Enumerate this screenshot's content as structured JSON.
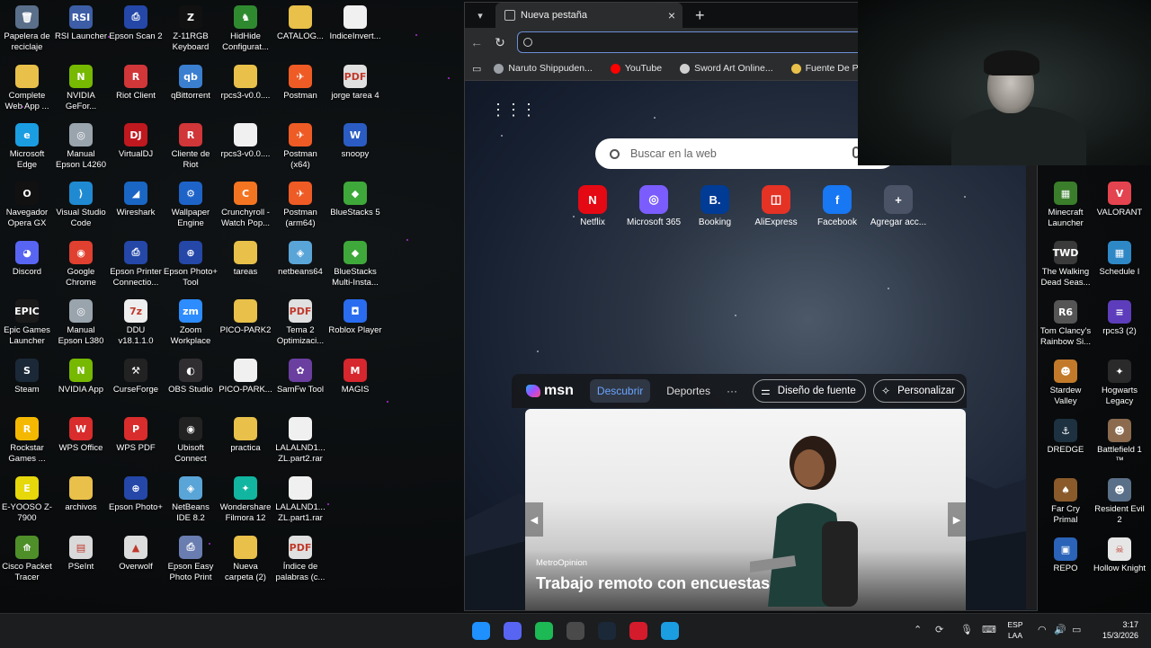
{
  "desktop": {
    "left_icons": [
      {
        "label": "Papelera de reciclaje",
        "icon": "recycle-bin-icon",
        "color": "#5a6f8a",
        "glyph": "🗑"
      },
      {
        "label": "RSI Launcher",
        "icon": "rsi-launcher-icon",
        "color": "#3d5ea6",
        "glyph": "RSI"
      },
      {
        "label": "Epson Scan 2",
        "icon": "epson-scan-icon",
        "color": "#2447a8",
        "glyph": "⎙"
      },
      {
        "label": "Z-11RGB Keyboard",
        "icon": "keyboard-icon",
        "color": "#111111",
        "glyph": "Z"
      },
      {
        "label": "HidHide Configurat...",
        "icon": "hidhide-icon",
        "color": "#2f8a2f",
        "glyph": "♞"
      },
      {
        "label": "CATALOG...",
        "icon": "folder-icon",
        "color": "#e8c04a",
        "glyph": ""
      },
      {
        "label": "IndiceInvert...",
        "icon": "file-icon",
        "color": "#f0f0f0",
        "glyph": ""
      },
      {
        "label": "Complete Web App ...",
        "icon": "folder-icon",
        "color": "#e8c04a",
        "glyph": ""
      },
      {
        "label": "NVIDIA GeFor...",
        "icon": "nvidia-icon",
        "color": "#76b900",
        "glyph": "N"
      },
      {
        "label": "Riot Client",
        "icon": "riot-icon",
        "color": "#d13639",
        "glyph": "R"
      },
      {
        "label": "qBittorrent",
        "icon": "qbittorrent-icon",
        "color": "#3b7fd1",
        "glyph": "qb"
      },
      {
        "label": "rpcs3-v0.0....",
        "icon": "folder-icon",
        "color": "#e8c04a",
        "glyph": ""
      },
      {
        "label": "Postman",
        "icon": "postman-icon",
        "color": "#ef5b25",
        "glyph": "✈"
      },
      {
        "label": "jorge tarea 4",
        "icon": "pdf-icon",
        "color": "#e0e0e0",
        "glyph": "PDF"
      },
      {
        "label": "Microsoft Edge",
        "icon": "edge-icon",
        "color": "#1b9de2",
        "glyph": "e"
      },
      {
        "label": "Manual Epson L4260",
        "icon": "cd-icon",
        "color": "#9aa4ad",
        "glyph": "◎"
      },
      {
        "label": "VirtualDJ",
        "icon": "virtualdj-icon",
        "color": "#c0181f",
        "glyph": "DJ"
      },
      {
        "label": "Cliente de Riot",
        "icon": "riot-icon",
        "color": "#d13639",
        "glyph": "R"
      },
      {
        "label": "rpcs3-v0.0....",
        "icon": "file-icon",
        "color": "#f0f0f0",
        "glyph": ""
      },
      {
        "label": "Postman (x64)",
        "icon": "postman-icon",
        "color": "#ef5b25",
        "glyph": "✈"
      },
      {
        "label": "snoopy",
        "icon": "word-icon",
        "color": "#2b5cc4",
        "glyph": "W"
      },
      {
        "label": "Navegador Opera GX",
        "icon": "opera-gx-icon",
        "color": "#111111",
        "glyph": "O"
      },
      {
        "label": "Visual Studio Code",
        "icon": "vscode-icon",
        "color": "#1f8ad2",
        "glyph": "⟩"
      },
      {
        "label": "Wireshark",
        "icon": "wireshark-icon",
        "color": "#1a66c4",
        "glyph": "◢"
      },
      {
        "label": "Wallpaper Engine",
        "icon": "wallpaper-engine-icon",
        "color": "#1e64c8",
        "glyph": "⚙"
      },
      {
        "label": "Crunchyroll - Watch Pop...",
        "icon": "crunchyroll-icon",
        "color": "#f47521",
        "glyph": "C"
      },
      {
        "label": "Postman (arm64)",
        "icon": "postman-icon",
        "color": "#ef5b25",
        "glyph": "✈"
      },
      {
        "label": "BlueStacks 5",
        "icon": "bluestacks-icon",
        "color": "#3fa83a",
        "glyph": "◆"
      },
      {
        "label": "Discord",
        "icon": "discord-icon",
        "color": "#5865f2",
        "glyph": "◕"
      },
      {
        "label": "Google Chrome",
        "icon": "chrome-icon",
        "color": "#e0402f",
        "glyph": "◉"
      },
      {
        "label": "Epson Printer Connectio...",
        "icon": "epson-printer-icon",
        "color": "#2447a8",
        "glyph": "⎙"
      },
      {
        "label": "Epson Photo+ Tool",
        "icon": "epson-photo-icon",
        "color": "#2447a8",
        "glyph": "⊕"
      },
      {
        "label": "tareas",
        "icon": "folder-icon",
        "color": "#e8c04a",
        "glyph": ""
      },
      {
        "label": "netbeans64",
        "icon": "netbeans-icon",
        "color": "#5aa5d8",
        "glyph": "◈"
      },
      {
        "label": "BlueStacks Multi-Insta...",
        "icon": "bluestacks-icon",
        "color": "#3fa83a",
        "glyph": "◆"
      },
      {
        "label": "Epic Games Launcher",
        "icon": "epic-games-icon",
        "color": "#1a1a1a",
        "glyph": "EPIC"
      },
      {
        "label": "Manual Epson L380",
        "icon": "cd-icon",
        "color": "#9aa4ad",
        "glyph": "◎"
      },
      {
        "label": "DDU v18.1.1.0",
        "icon": "ddu-icon",
        "color": "#eeeeee",
        "glyph": "7z"
      },
      {
        "label": "Zoom Workplace",
        "icon": "zoom-icon",
        "color": "#2d8cff",
        "glyph": "zm"
      },
      {
        "label": "PICO-PARK2",
        "icon": "folder-icon",
        "color": "#e8c04a",
        "glyph": ""
      },
      {
        "label": "Tema 2 Optimizaci...",
        "icon": "pdf-icon",
        "color": "#e0e0e0",
        "glyph": "PDF"
      },
      {
        "label": "Roblox Player",
        "icon": "roblox-icon",
        "color": "#2a6cf0",
        "glyph": "◘"
      },
      {
        "label": "Steam",
        "icon": "steam-icon",
        "color": "#1b2838",
        "glyph": "S"
      },
      {
        "label": "NVIDIA App",
        "icon": "nvidia-icon",
        "color": "#76b900",
        "glyph": "N"
      },
      {
        "label": "CurseForge",
        "icon": "curseforge-icon",
        "color": "#222222",
        "glyph": "⚒"
      },
      {
        "label": "OBS Studio",
        "icon": "obs-icon",
        "color": "#302e31",
        "glyph": "◐"
      },
      {
        "label": "PICO-PARK...",
        "icon": "file-icon",
        "color": "#f0f0f0",
        "glyph": ""
      },
      {
        "label": "SamFw Tool",
        "icon": "samfw-icon",
        "color": "#6b3fa0",
        "glyph": "✿"
      },
      {
        "label": "MAGIS",
        "icon": "magis-icon",
        "color": "#d6262e",
        "glyph": "M"
      },
      {
        "label": "Rockstar Games ...",
        "icon": "rockstar-icon",
        "color": "#f5b800",
        "glyph": "R"
      },
      {
        "label": "WPS Office",
        "icon": "wps-office-icon",
        "color": "#d92c2c",
        "glyph": "W"
      },
      {
        "label": "WPS PDF",
        "icon": "wps-pdf-icon",
        "color": "#d92c2c",
        "glyph": "P"
      },
      {
        "label": "Ubisoft Connect",
        "icon": "ubisoft-icon",
        "color": "#222222",
        "glyph": "◉"
      },
      {
        "label": "practica",
        "icon": "folder-icon",
        "color": "#e8c04a",
        "glyph": ""
      },
      {
        "label": "LALALND1... ZL.part2.rar",
        "icon": "file-icon",
        "color": "#f0f0f0",
        "glyph": ""
      },
      {
        "label": "E-YOOSO Z-7900",
        "icon": "eyooso-icon",
        "color": "#e6d80b",
        "glyph": "E"
      },
      {
        "label": "archivos",
        "icon": "folder-icon",
        "color": "#e8c04a",
        "glyph": ""
      },
      {
        "label": "Epson Photo+",
        "icon": "epson-photo-icon",
        "color": "#2447a8",
        "glyph": "⊕"
      },
      {
        "label": "NetBeans IDE 8.2",
        "icon": "netbeans-icon",
        "color": "#5aa5d8",
        "glyph": "◈"
      },
      {
        "label": "Wondershare Filmora 12",
        "icon": "filmora-icon",
        "color": "#11b5a0",
        "glyph": "✦"
      },
      {
        "label": "LALALND1... ZL.part1.rar",
        "icon": "file-icon",
        "color": "#f0f0f0",
        "glyph": ""
      },
      {
        "label": "Cisco Packet Tracer",
        "icon": "cisco-packet-tracer-icon",
        "color": "#4f8f2a",
        "glyph": "⟰"
      },
      {
        "label": "PSeInt",
        "icon": "pseint-icon",
        "color": "#d9d9d9",
        "glyph": "▤"
      },
      {
        "label": "Overwolf",
        "icon": "overwolf-icon",
        "color": "#dddddd",
        "glyph": "▲"
      },
      {
        "label": "Epson Easy Photo Print",
        "icon": "epson-easy-photo-icon",
        "color": "#6a7db0",
        "glyph": "⎙"
      },
      {
        "label": "Nueva carpeta (2)",
        "icon": "folder-icon",
        "color": "#e8c04a",
        "glyph": ""
      },
      {
        "label": "Índice de palabras (c...",
        "icon": "pdf-icon",
        "color": "#e0e0e0",
        "glyph": "PDF"
      }
    ],
    "right_icons": [
      {
        "label": "Minecraft Launcher",
        "icon": "minecraft-icon",
        "color": "#3a7d2a",
        "glyph": "▦"
      },
      {
        "label": "VALORANT",
        "icon": "valorant-icon",
        "color": "#e4444f",
        "glyph": "V"
      },
      {
        "label": "The Walking Dead Seas...",
        "icon": "walking-dead-icon",
        "color": "#3a3a3a",
        "glyph": "TWD"
      },
      {
        "label": "Schedule I",
        "icon": "schedule-icon",
        "color": "#2f88c6",
        "glyph": "▦"
      },
      {
        "label": "Tom Clancy's Rainbow Si...",
        "icon": "rainbow-six-icon",
        "color": "#555555",
        "glyph": "R6"
      },
      {
        "label": "rpcs3 (2)",
        "icon": "rpcs3-icon",
        "color": "#5d3dbb",
        "glyph": "≡"
      },
      {
        "label": "Stardew Valley",
        "icon": "stardew-icon",
        "color": "#c27a2a",
        "glyph": "☻"
      },
      {
        "label": "Hogwarts Legacy",
        "icon": "hogwarts-icon",
        "color": "#2a2a2a",
        "glyph": "✦"
      },
      {
        "label": "DREDGE",
        "icon": "dredge-icon",
        "color": "#1d3140",
        "glyph": "⚓"
      },
      {
        "label": "Battlefield 1 ™",
        "icon": "battlefield-icon",
        "color": "#8b6a4e",
        "glyph": "☻"
      },
      {
        "label": "Far Cry Primal",
        "icon": "far-cry-icon",
        "color": "#8a5a2b",
        "glyph": "♠"
      },
      {
        "label": "Resident Evil 2",
        "icon": "resident-evil-icon",
        "color": "#5a6f88",
        "glyph": "☻"
      },
      {
        "label": "REPO",
        "icon": "repo-icon",
        "color": "#2a63b8",
        "glyph": "▣"
      },
      {
        "label": "Hollow Knight",
        "icon": "hollow-knight-icon",
        "color": "#e6e6e6",
        "glyph": "☠"
      }
    ]
  },
  "browser": {
    "tab_title": "Nueva pestaña",
    "address_value": "",
    "favorites": [
      {
        "label": "Naruto Shippuden...",
        "icon": "globe-icon",
        "color": "#9aa0a6"
      },
      {
        "label": "YouTube",
        "icon": "youtube-icon",
        "color": "#ff0000"
      },
      {
        "label": "Sword Art Online...",
        "icon": "sword-icon",
        "color": "#cfcfcf"
      },
      {
        "label": "Fuente De Po",
        "icon": "folder-icon",
        "color": "#e8c04a"
      }
    ],
    "ntp": {
      "search_placeholder": "Buscar en la web",
      "quick_links": [
        {
          "label": "Netflix",
          "icon": "netflix-icon",
          "color": "#e50914",
          "glyph": "N"
        },
        {
          "label": "Microsoft 365",
          "icon": "microsoft-365-icon",
          "color": "#7a5cff",
          "glyph": "◎"
        },
        {
          "label": "Booking",
          "icon": "booking-icon",
          "color": "#003b95",
          "glyph": "B."
        },
        {
          "label": "AliExpress",
          "icon": "aliexpress-icon",
          "color": "#e43225",
          "glyph": "◫"
        },
        {
          "label": "Facebook",
          "icon": "facebook-icon",
          "color": "#1877f2",
          "glyph": "f"
        },
        {
          "label": "Agregar acc...",
          "icon": "plus-icon",
          "color": "#4a5466",
          "glyph": "+"
        }
      ],
      "msn": {
        "logo": "msn",
        "tab_active": "Descubrir",
        "tab2": "Deportes",
        "more": "···",
        "btn_font": "Diseño de fuente",
        "btn_personalize": "Personalizar",
        "hero_source": "MetroOpinion",
        "hero_title": "Trabajo remoto con encuestas"
      }
    }
  },
  "taskbar": {
    "apps": [
      {
        "icon": "windows-start-icon",
        "color": "#1e90ff"
      },
      {
        "icon": "discord-icon",
        "color": "#5865f2"
      },
      {
        "icon": "spotify-icon",
        "color": "#1db954"
      },
      {
        "icon": "obs-icon",
        "color": "#4a4a4a"
      },
      {
        "icon": "steam-icon",
        "color": "#1b2838"
      },
      {
        "icon": "opera-gx-icon",
        "color": "#d41b2c"
      },
      {
        "icon": "edge-icon",
        "color": "#1b9de2"
      }
    ],
    "lang_line1": "ESP",
    "lang_line2": "LAA",
    "time": "3:17",
    "date": "15/3/2026"
  }
}
